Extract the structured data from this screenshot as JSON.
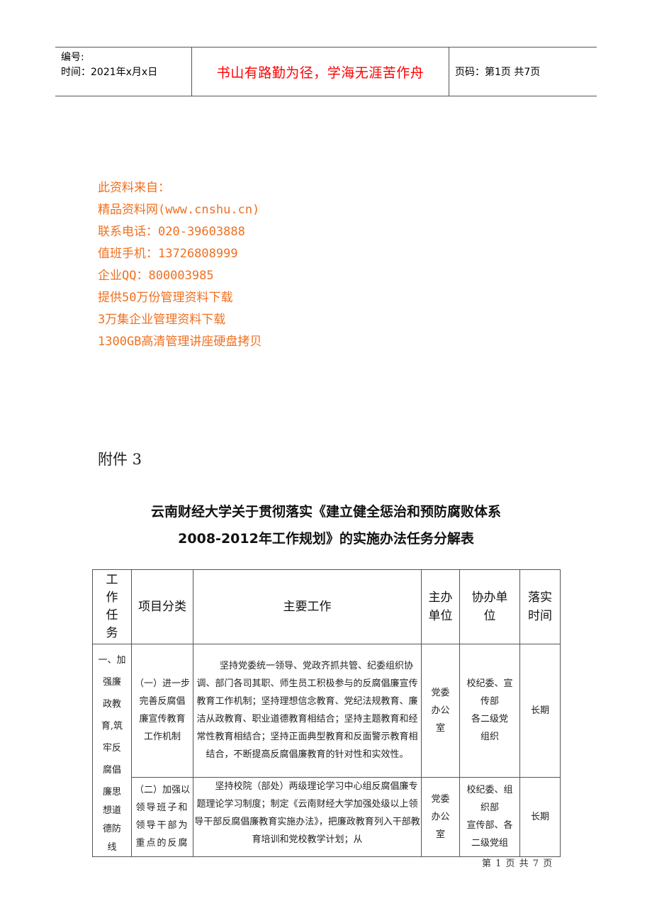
{
  "header": {
    "number_label": "编号:",
    "date_label": "时间：2021年x月x日",
    "motto": "书山有路勤为径，学海无涯苦作舟",
    "page_label": "页码：第1页 共7页",
    "motto_color": "#ff0000"
  },
  "source": {
    "color": "#f07020",
    "lines": [
      "此资料来自：",
      "精品资料网(www.cnshu.cn)",
      "联系电话：020-39603888",
      "值班手机：13726808999",
      "企业QQ：800003985",
      "提供50万份管理资料下载",
      "3万集企业管理资料下载",
      "1300GB高清管理讲座硬盘拷贝"
    ]
  },
  "attachment": "附件 3",
  "title": {
    "line1": "云南财经大学关于贯彻落实《建立健全惩治和预防腐败体系",
    "line2": "2008-2012年工作规划》的实施办法任务分解表"
  },
  "table": {
    "headers": {
      "task": [
        "工",
        "作",
        "任",
        "务"
      ],
      "category": "项目分类",
      "work": "主要工作",
      "lead": [
        "主办",
        "单位"
      ],
      "assist": [
        "协办单",
        "位"
      ],
      "time": [
        "落实",
        "时间"
      ]
    },
    "task_group": {
      "lines": [
        "一、加",
        "强廉",
        "政教",
        "育,筑",
        "牢反",
        "腐倡",
        "廉思",
        "想道",
        "德防",
        "线"
      ]
    },
    "rows": [
      {
        "category": [
          "（一）进一步",
          "完善反腐倡",
          "廉宣传教育",
          "工作机制"
        ],
        "work": "坚持党委统一领导、党政齐抓共管、纪委组织协调、部门各司其职、师生员工积极参与的反腐倡廉宣传教育工作机制；坚持理想信念教育、党纪法规教育、廉洁从政教育、职业道德教育相结合；坚持主题教育和经常性教育相结合；坚持正面典型教育和反面警示教育相结合，不断提高反腐倡廉教育的针对性和实效性。",
        "lead": [
          "党委",
          "办公",
          "室"
        ],
        "assist": [
          "校纪委、宣",
          "传部",
          "各二级党",
          "组织"
        ],
        "time": "长期"
      },
      {
        "category": [
          "（二）加强以",
          "领导班子和",
          "领导干部为",
          "重点的反腐"
        ],
        "work": "坚持校院（部处）两级理论学习中心组反腐倡廉专题理论学习制度；制定《云南财经大学加强处级以上领导干部反腐倡廉教育实施办法》，把廉政教育列入干部教育培训和党校教学计划；从",
        "lead": [
          "党委",
          "办公",
          "室"
        ],
        "assist": [
          "校纪委、组",
          "织部",
          "宣传部、各",
          "二级党组"
        ],
        "time": "长期"
      }
    ]
  },
  "footer": "第 1 页 共 7 页"
}
